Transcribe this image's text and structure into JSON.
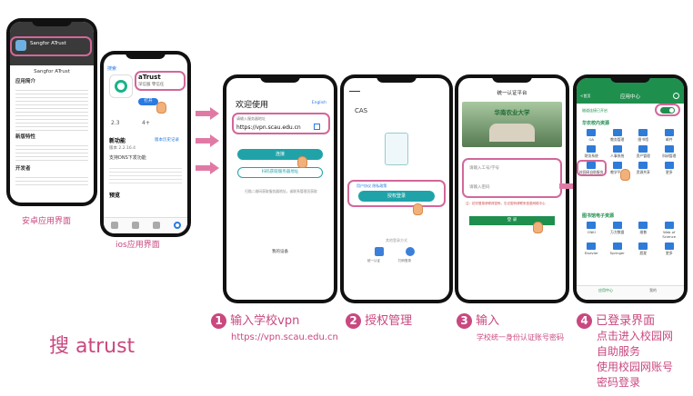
{
  "phone1": {
    "app_name": "Sangfor ATrust",
    "title": "Sangfor ATrust",
    "section1": "应用简介",
    "section2": "新版特性",
    "section3": "开发者",
    "caption": "安卓应用界面"
  },
  "phone2": {
    "back": "搜索",
    "app_name": "aTrust",
    "subtitle": "深信服 零信任",
    "open_button": "打开",
    "rating": "2.3",
    "rank": "4+",
    "features_title": "新功能",
    "history_link": "版本历史记录",
    "version": "版本 2.2.16.4",
    "note": "支持DNS下发功能",
    "preview_title": "预览",
    "caption": "ios应用界面"
  },
  "phone3": {
    "welcome": "欢迎使用",
    "language": "English",
    "addr_label": "请输入服务器地址",
    "addr_value": "https://vpn.scau.edu.cn",
    "connect": "连接",
    "scan": "扫码获取服务器地址",
    "hint": "扫描二维码获取服务器地址，或联系管理员获取",
    "footer": "我的设备"
  },
  "phone4": {
    "title": "CAS",
    "agreement": "用户协议  隐私政策",
    "login": "授权登录",
    "other": "其他登录方式",
    "opt1": "统一认证",
    "opt2": "扫码登录"
  },
  "phone5": {
    "header": "统一认证平台",
    "school": "华南农业大学",
    "user_placeholder": "请输入工号/学号",
    "pass_placeholder": "请输入密码",
    "tips": "注：初次登录请修改密码，忘记密码请联系信息网络中心",
    "login": "登 录"
  },
  "phone6": {
    "back": "<首页",
    "header": "应用中心",
    "toggle_label": "隧道连接已开启",
    "section1": "华农校内资源",
    "apps1": [
      "OA",
      "教务管理",
      "图书馆",
      "邮件",
      "财务系统",
      "人事系统",
      "资产管理",
      "科研管理",
      "校园网自助服务",
      "教学平台",
      "资源共享",
      "更多"
    ],
    "section2": "图书馆电子资源",
    "apps2": [
      "CNKI",
      "万方数据",
      "维普",
      "Web of Science",
      "Elsevier",
      "Springer",
      "超星",
      "更多"
    ],
    "tab1": "应用中心",
    "tab2": "我的"
  },
  "captions": {
    "search": "搜 atrust",
    "step1_title": "输入学校vpn",
    "step1_url": "https://vpn.scau.edu.cn",
    "step2_title": "授权管理",
    "step3_title": "输入",
    "step3_sub": "学校统一身份认证账号密码",
    "step4_l1": "已登录界面",
    "step4_l2": "点击进入校园网",
    "step4_l3": "自助服务",
    "step4_l4": "使用校园网账号",
    "step4_l5": "密码登录",
    "num1": "1",
    "num2": "2",
    "num3": "3",
    "num4": "4"
  }
}
